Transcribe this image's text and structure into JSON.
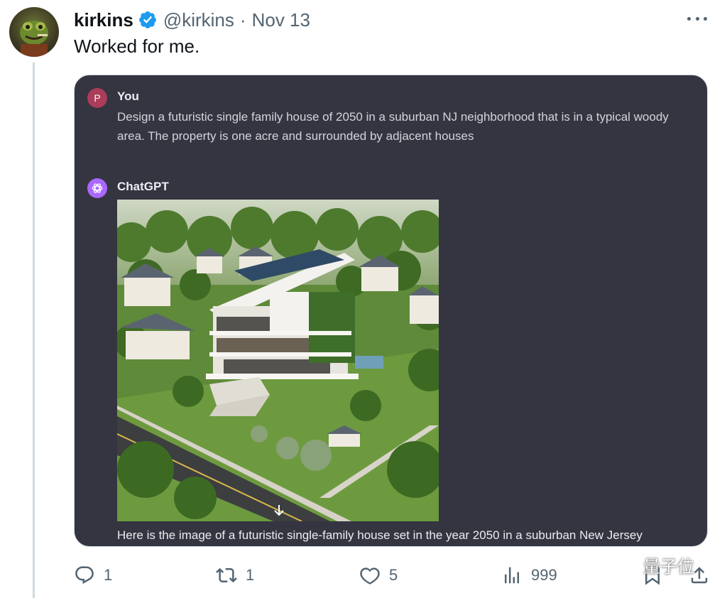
{
  "tweet": {
    "author_name": "kirkins",
    "handle": "@kirkins",
    "separator": "·",
    "date": "Nov 13",
    "text": "Worked for me."
  },
  "chat": {
    "user_avatar_letter": "P",
    "user_label": "You",
    "prompt": "Design a futuristic single family house of 2050 in a suburban NJ neighborhood that is in a typical woody area. The property is one acre and surrounded by adjacent houses",
    "assistant_label": "ChatGPT",
    "response": "Here is the image of a futuristic single-family house set in the year 2050 in a suburban New Jersey"
  },
  "actions": {
    "replies": "1",
    "retweets": "1",
    "likes": "5",
    "views": "999"
  },
  "watermark": "量子位",
  "icons": {
    "verified": "verified-badge-icon",
    "more": "more-icon",
    "reply": "reply-icon",
    "retweet": "retweet-icon",
    "like": "heart-icon",
    "views": "views-icon",
    "bookmark": "bookmark-icon",
    "share": "share-icon",
    "download": "download-icon",
    "openai": "openai-logo-icon"
  },
  "colors": {
    "verified_blue": "#1d9bf0",
    "chat_bg": "#343541",
    "user_avatar": "#ab3c5a",
    "gpt_avatar": "#ab68ff",
    "muted_text": "#536471"
  }
}
